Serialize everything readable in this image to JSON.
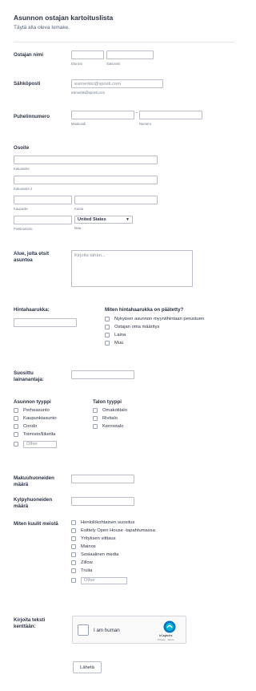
{
  "header": {
    "title": "Asunnon ostajan kartoituslista",
    "subtitle": "Täytä alla oleva lomake."
  },
  "buyer_name": {
    "label": "Ostajan nimi",
    "first_sub": "Etunimi",
    "last_sub": "Sukunimi",
    "first_value": "",
    "last_value": ""
  },
  "email": {
    "label": "Sähköposti",
    "placeholder": "esimerkki@sposti.com",
    "sub": "esimerkki@sposti.com"
  },
  "phone": {
    "label": "Puhelinnumero",
    "area_sub": "Maakoodi",
    "number_sub": "Numero",
    "separator": "-"
  },
  "address": {
    "label": "Osoite",
    "street_sub": "Katuosoite",
    "street2_sub": "Katuosoite 2",
    "city_sub": "Kaupunki",
    "state_sub": "Kunta",
    "zip_sub": "Postinumero",
    "country_sub": "Maa",
    "country_value": "United States"
  },
  "area": {
    "label": "Alue, jolta etsit asuntoa",
    "placeholder": "Kirjoita tähän..."
  },
  "price": {
    "label": "Hintahaarukka:"
  },
  "price_basis": {
    "label": "Miten hintahaarukka on päätetty?",
    "options": [
      "Nykyisen asunnon myyntihintaan perustuen",
      "Ostajan oma määritys",
      "Laina",
      "Muu"
    ]
  },
  "lender": {
    "label": "Suosittu lainanantaja:"
  },
  "home_type": {
    "label": "Asunnon tyyppi",
    "options": [
      "Perheasunto",
      "Kaupunkiasunto",
      "Condo",
      "Toimisto/liiketila"
    ],
    "other_placeholder": "Other"
  },
  "house_type": {
    "label": "Talon tyyppi",
    "options": [
      "Omakotitalo",
      "Rivitalo",
      "Kerrostalo"
    ]
  },
  "bedrooms": {
    "label": "Makuuhuoneiden määrä"
  },
  "bathrooms": {
    "label": "Kylpyhuoneiden määrä"
  },
  "heard": {
    "label": "Miten kuulit meistä",
    "options": [
      "Henkilökohtainen suositus",
      "Esittely Open House -tapahtumassa",
      "Yrityksen viittaus",
      "Mainos",
      "Sosiaalinen media",
      "Zillow",
      "Trulia"
    ],
    "other_placeholder": "Other"
  },
  "captcha": {
    "label": "Kirjoita teksti kenttään:",
    "text": "I am human",
    "brand": "hCaptcha",
    "links": "Privacy · Terms"
  },
  "submit": {
    "label": "Lähetä"
  }
}
